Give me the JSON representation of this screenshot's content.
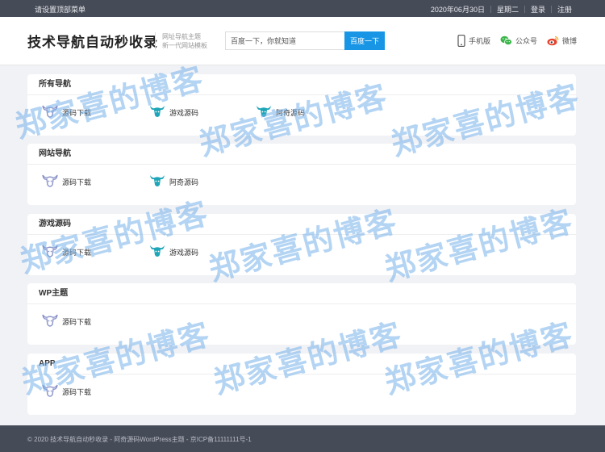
{
  "topbar": {
    "menu_label": "请设置顶部菜单",
    "date": "2020年06月30日",
    "weekday": "星期二",
    "login": "登录",
    "register": "注册"
  },
  "header": {
    "logo": "技术导航自动秒收录",
    "slogan_line1": "网址导航主题",
    "slogan_line2": "新一代网站模板",
    "search_placeholder": "百度一下，你就知道",
    "search_button": "百度一下",
    "links": {
      "mobile": "手机版",
      "wechat": "公众号",
      "weibo": "微博"
    }
  },
  "sections": [
    {
      "title": "所有导航",
      "items": [
        {
          "label": "源码下载",
          "icon_color": "#8a93c9"
        },
        {
          "label": "游戏源码",
          "icon_color": "#1ea6b8"
        },
        {
          "label": "阿奇源码",
          "icon_color": "#1ea6b8"
        }
      ]
    },
    {
      "title": "网站导航",
      "items": [
        {
          "label": "源码下载",
          "icon_color": "#8a93c9"
        },
        {
          "label": "阿奇源码",
          "icon_color": "#1ea6b8"
        }
      ]
    },
    {
      "title": "游戏源码",
      "items": [
        {
          "label": "源码下载",
          "icon_color": "#8a93c9"
        },
        {
          "label": "游戏源码",
          "icon_color": "#1ea6b8"
        }
      ]
    },
    {
      "title": "WP主题",
      "items": [
        {
          "label": "源码下载",
          "icon_color": "#8a93c9"
        }
      ]
    },
    {
      "title": "APP",
      "items": [
        {
          "label": "源码下载",
          "icon_color": "#8a93c9"
        }
      ]
    }
  ],
  "footer": {
    "text": "© 2020 技术导航自动秒收录 - 阿奇源码WordPress主题 - 京ICP备11111111号-1"
  },
  "watermark": {
    "text": "郑家喜的博客"
  },
  "colors": {
    "topbar_bg": "#464b58",
    "accent": "#1896e5",
    "watermark": "#76b0ea"
  }
}
